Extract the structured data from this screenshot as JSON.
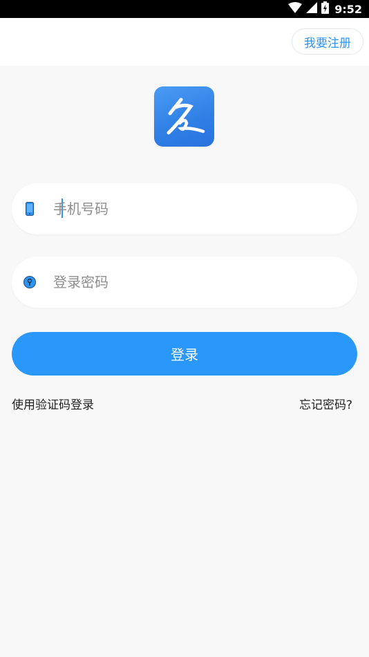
{
  "status_bar": {
    "time": "9:52",
    "icons": [
      "wifi-icon",
      "cell-signal-icon",
      "battery-charging-icon"
    ]
  },
  "header": {
    "register_label": "我要注册"
  },
  "logo": {
    "icon": "app-logo-icon",
    "brand_color": "#2f7fe6"
  },
  "form": {
    "phone": {
      "icon": "phone-icon",
      "placeholder": "手机号码",
      "value": ""
    },
    "password": {
      "icon": "lock-icon",
      "placeholder": "登录密码",
      "value": ""
    },
    "login_label": "登录",
    "login_color": "#2a98fb"
  },
  "links": {
    "sms_login": "使用验证码登录",
    "forgot_password": "忘记密码?"
  }
}
